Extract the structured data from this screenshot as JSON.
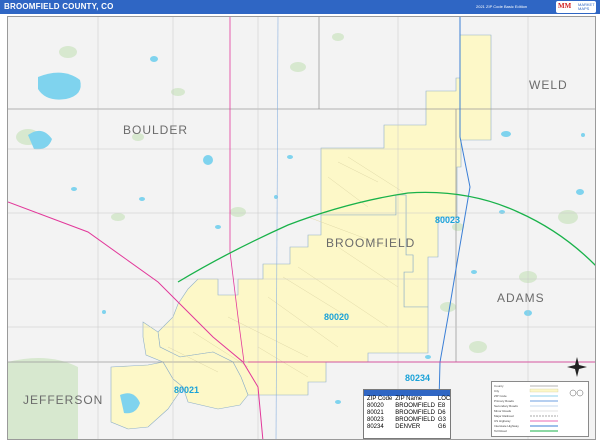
{
  "header": {
    "title": "BROOMFIELD COUNTY, CO",
    "edition": "2021 ZIP Code Basic Edition",
    "logo_main": "MM",
    "logo_sub": "MARKET MAPS"
  },
  "counties": {
    "boulder": "BOULDER",
    "weld": "WELD",
    "broomfield": "BROOMFIELD",
    "adams": "ADAMS",
    "jefferson": "JEFFERSON"
  },
  "zips": {
    "z80020": "80020",
    "z80021": "80021",
    "z80023": "80023",
    "z80234": "80234"
  },
  "zip_table": {
    "headers": [
      "ZIP Code",
      "ZIP Name",
      "LOC"
    ],
    "rows": [
      [
        "80020",
        "BROOMFIELD",
        "E8"
      ],
      [
        "80021",
        "BROOMFIELD",
        "D6"
      ],
      [
        "80023",
        "BROOMFIELD",
        "G3"
      ],
      [
        "80234",
        "DENVER",
        "G6"
      ]
    ]
  },
  "legend": {
    "items": [
      "County",
      "City",
      "ZIP Code",
      "Primary Roads",
      "Secondary Roads",
      "Minor Roads",
      "Major Railroad",
      "US Highway",
      "Interstate Highway",
      "Toll Road"
    ]
  },
  "colors": {
    "header_bg": "#2f66c4",
    "zip_area": "#fdf8c8",
    "zip_label": "#1aa2d8",
    "water": "#7fd3ee",
    "park": "#d7e8cf",
    "highway_green": "#19b24a",
    "pink_road": "#e2389a",
    "county_line": "#9a9a9a"
  }
}
